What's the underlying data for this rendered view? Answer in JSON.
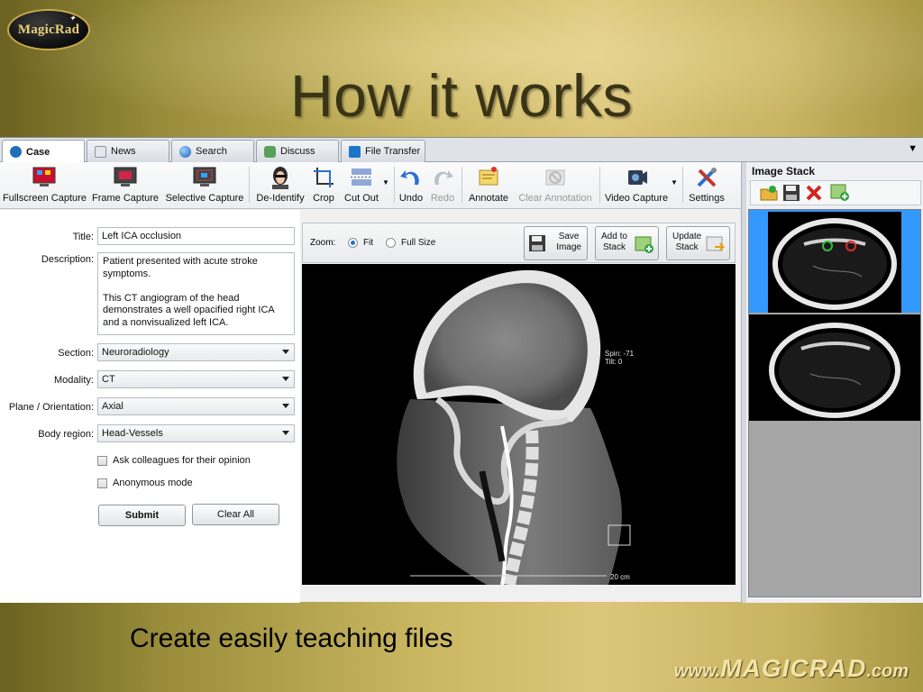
{
  "slide": {
    "logo_text": "MagicRad",
    "title": "How it works",
    "caption": "Create easily teaching files",
    "site_prefix": "www.",
    "site_name": "MAGICRAD",
    "site_suffix": ".com"
  },
  "tabs": [
    {
      "label": "Case",
      "active": true,
      "icon": "case-icon"
    },
    {
      "label": "News",
      "active": false,
      "icon": "news-icon"
    },
    {
      "label": "Search",
      "active": false,
      "icon": "search-icon"
    },
    {
      "label": "Discuss",
      "active": false,
      "icon": "discuss-icon"
    },
    {
      "label": "File Transfer",
      "active": false,
      "icon": "file-transfer-icon"
    }
  ],
  "toolbar": {
    "fullscreen_capture": "Fullscreen Capture",
    "frame_capture": "Frame Capture",
    "selective_capture": "Selective Capture",
    "de_identify": "De-Identify",
    "crop": "Crop",
    "cut_out": "Cut Out",
    "undo": "Undo",
    "redo": "Redo",
    "annotate": "Annotate",
    "clear_annotation": "Clear Annotation",
    "video_capture": "Video Capture",
    "settings": "Settings"
  },
  "form": {
    "title_label": "Title:",
    "title_value": "Left ICA occlusion",
    "description_label": "Description:",
    "description_value": "Patient presented with acute stroke symptoms.\n\nThis CT angiogram of the head demonstrates a well opacified right ICA and a nonvisualized left ICA.",
    "section_label": "Section:",
    "section_value": "Neuroradiology",
    "modality_label": "Modality:",
    "modality_value": "CT",
    "plane_label": "Plane / Orientation:",
    "plane_value": "Axial",
    "body_region_label": "Body region:",
    "body_region_value": "Head-Vessels",
    "ask_colleagues": "Ask colleagues for their opinion",
    "anonymous_mode": "Anonymous mode",
    "submit": "Submit",
    "clear_all": "Clear All"
  },
  "viewer": {
    "zoom_label": "Zoom:",
    "zoom_fit": "Fit",
    "zoom_full_size": "Full Size",
    "zoom_selected": "Fit",
    "save_image": "Save\nImage",
    "add_to_stack": "Add to\nStack",
    "update_stack": "Update\nStack",
    "spin_text": "Spin: -71",
    "tilt_text": "Tilt:  0",
    "scale_text": "20 cm"
  },
  "image_stack": {
    "title": "Image Stack",
    "thumbnails": 2,
    "selected_index": 0
  },
  "colors": {
    "selection_blue": "#3399ff",
    "title_text": "#3a3416",
    "site_text": "#f3e4a6"
  }
}
